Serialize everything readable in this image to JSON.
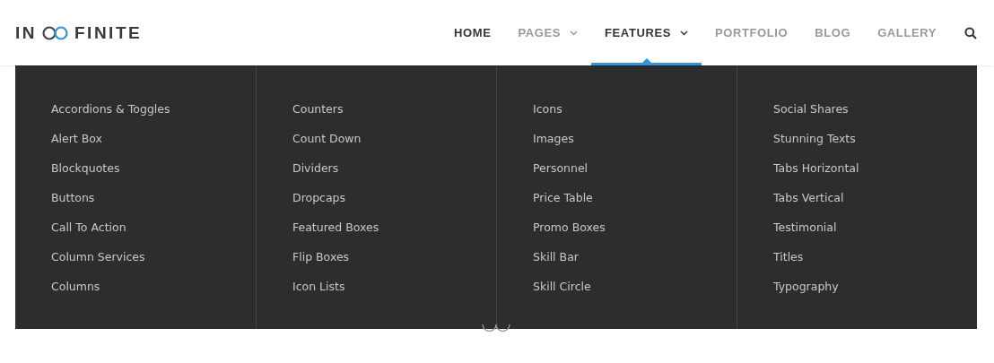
{
  "logo": {
    "left": "IN",
    "right": "FINITE"
  },
  "nav": [
    {
      "label": "HOME",
      "dark": true,
      "dropdown": false,
      "selected": false
    },
    {
      "label": "PAGES",
      "dark": false,
      "dropdown": true,
      "selected": false
    },
    {
      "label": "FEATURES",
      "dark": true,
      "dropdown": true,
      "selected": true
    },
    {
      "label": "PORTFOLIO",
      "dark": false,
      "dropdown": false,
      "selected": false
    },
    {
      "label": "BLOG",
      "dark": false,
      "dropdown": false,
      "selected": false
    },
    {
      "label": "GALLERY",
      "dark": false,
      "dropdown": false,
      "selected": false
    }
  ],
  "menu_columns": [
    [
      "Accordions & Toggles",
      "Alert Box",
      "Blockquotes",
      "Buttons",
      "Call To Action",
      "Column Services",
      "Columns"
    ],
    [
      "Counters",
      "Count Down",
      "Dividers",
      "Dropcaps",
      "Featured Boxes",
      "Flip Boxes",
      "Icon Lists"
    ],
    [
      "Icons",
      "Images",
      "Personnel",
      "Price Table",
      "Promo Boxes",
      "Skill Bar",
      "Skill Circle"
    ],
    [
      "Social Shares",
      "Stunning Texts",
      "Tabs Horizontal",
      "Tabs Vertical",
      "Testimonial",
      "Titles",
      "Typography"
    ]
  ]
}
